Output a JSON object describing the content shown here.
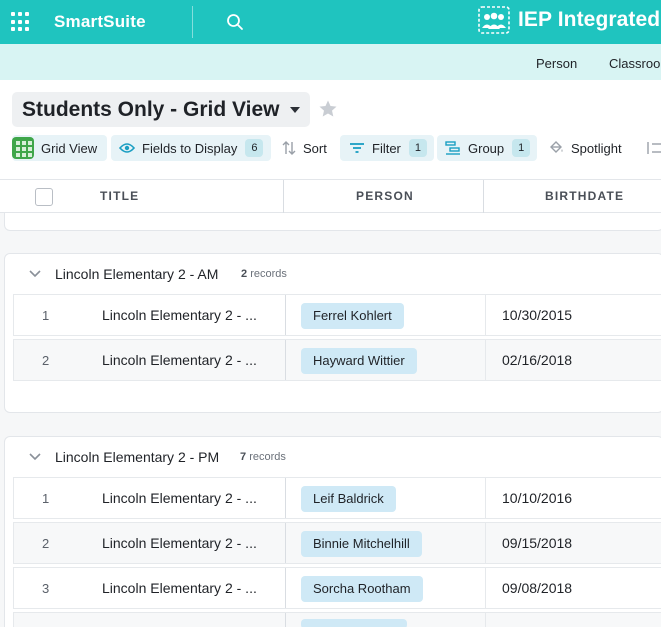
{
  "app": {
    "brand": "SmartSuite",
    "workspace_title": "IEP Integrated",
    "colors": {
      "accent": "#1fc4bf",
      "chip": "#cfe9f6",
      "grid_view_icon": "#3fa64a"
    },
    "icons": {
      "apps": "apps-grid-icon",
      "search": "search-icon",
      "workspace": "team-icon"
    }
  },
  "subnav": {
    "items": [
      "Person",
      "Classroo"
    ]
  },
  "view": {
    "title": "Students Only - Grid View",
    "icons": {
      "dropdown": "caret-down-icon",
      "favorite": "star-icon"
    }
  },
  "toolbar": {
    "grid_view": "Grid View",
    "fields": {
      "label": "Fields to Display",
      "count": "6"
    },
    "sort": "Sort",
    "filter": {
      "label": "Filter",
      "count": "1"
    },
    "group": {
      "label": "Group",
      "count": "1"
    },
    "spotlight": "Spotlight"
  },
  "columns": {
    "title": "TITLE",
    "person": "PERSON",
    "birthdate": "BIRTHDATE"
  },
  "groups": [
    {
      "name": "Lincoln Elementary 2 - AM",
      "count": "2",
      "count_label": "records",
      "rows": [
        {
          "num": "1",
          "title": "Lincoln Elementary 2 - ...",
          "person": "Ferrel Kohlert",
          "birthdate": "10/30/2015"
        },
        {
          "num": "2",
          "title": "Lincoln Elementary 2 - ...",
          "person": "Hayward Wittier",
          "birthdate": "02/16/2018"
        }
      ]
    },
    {
      "name": "Lincoln Elementary 2 - PM",
      "count": "7",
      "count_label": "records",
      "rows": [
        {
          "num": "1",
          "title": "Lincoln Elementary 2 - ...",
          "person": "Leif Baldrick",
          "birthdate": "10/10/2016"
        },
        {
          "num": "2",
          "title": "Lincoln Elementary 2 - ...",
          "person": "Binnie Mitchelhill",
          "birthdate": "09/15/2018"
        },
        {
          "num": "3",
          "title": "Lincoln Elementary 2 - ...",
          "person": "Sorcha Rootham",
          "birthdate": "09/08/2018"
        }
      ]
    }
  ]
}
